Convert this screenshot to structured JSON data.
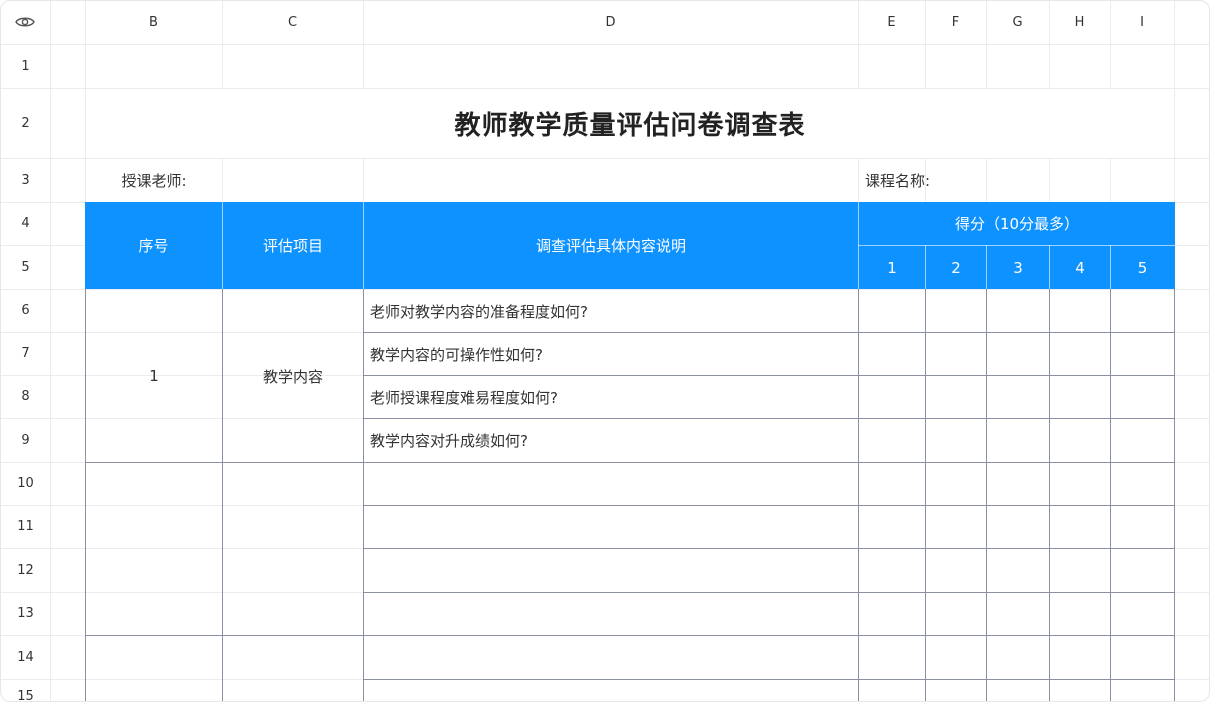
{
  "column_headers": [
    "B",
    "C",
    "D",
    "E",
    "F",
    "G",
    "H",
    "I"
  ],
  "row_headers": [
    "1",
    "2",
    "3",
    "4",
    "5",
    "6",
    "7",
    "8",
    "9",
    "10",
    "11",
    "12",
    "13",
    "14",
    "15"
  ],
  "sheet": {
    "title": "教师教学质量评估问卷调查表",
    "teacher_label": "授课老师:",
    "course_label": "课程名称:",
    "table_header": {
      "seq": "序号",
      "item": "评估项目",
      "desc": "调查评估具体内容说明",
      "score": "得分（10分最多）",
      "score_cols": [
        "1",
        "2",
        "3",
        "4",
        "5"
      ]
    },
    "groups": [
      {
        "seq": "1",
        "item": "教学内容",
        "questions": [
          "老师对教学内容的准备程度如何?",
          "教学内容的可操作性如何?",
          "老师授课程度难易程度如何?",
          "教学内容对升成绩如何?"
        ]
      }
    ]
  },
  "colors": {
    "header_blue": "#0e92ff",
    "table_border": "#8a8fa3",
    "grid_line": "#ececec"
  },
  "icons": {
    "corner": "eye-icon"
  }
}
